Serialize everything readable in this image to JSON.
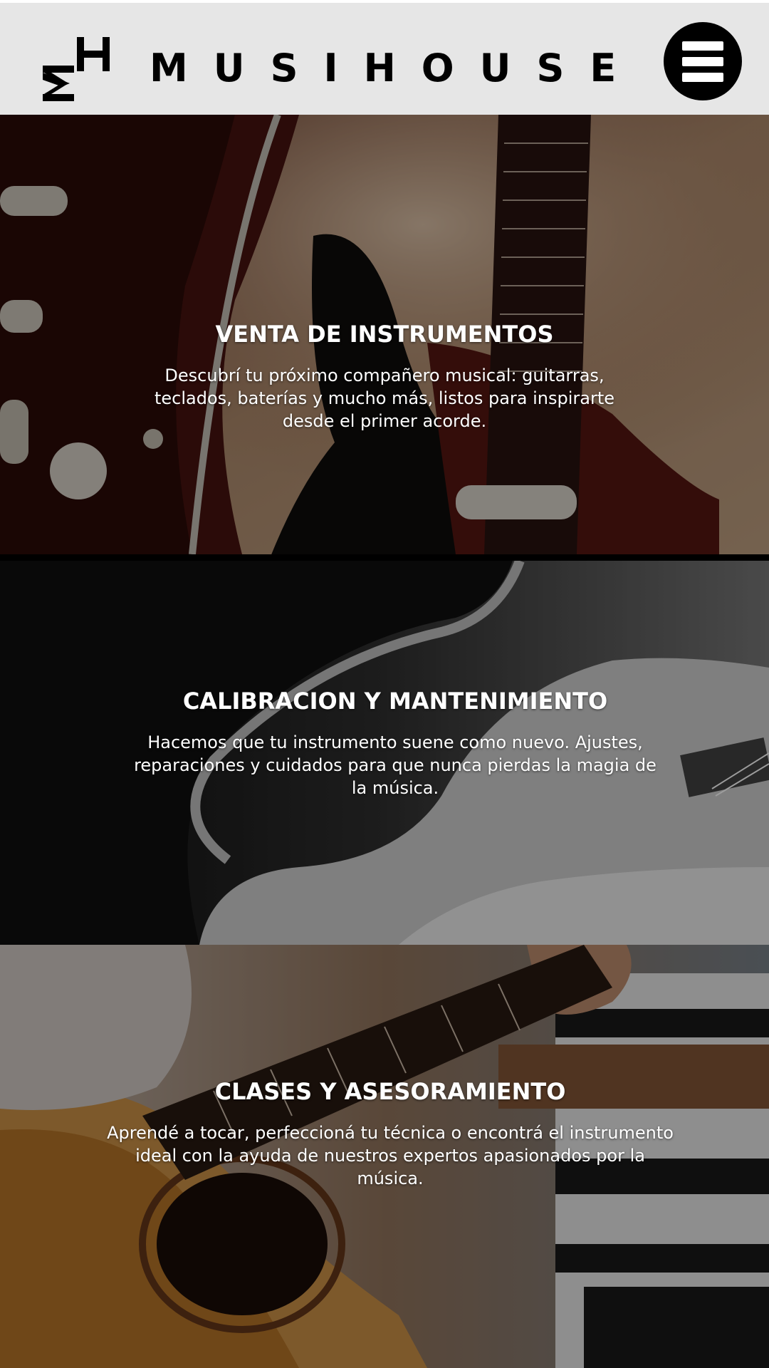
{
  "header": {
    "logo_text": "MH",
    "brand": "MUSIHOUSE",
    "menu_icon": "hamburger-menu-icon",
    "background": "#e6e6e6"
  },
  "sections": [
    {
      "title": "VENTA DE INSTRUMENTOS",
      "description": "Descubrí tu próximo compañero musical: guitarras, teclados, baterías y mucho más, listos para inspirarte desde el primer acorde.",
      "image": "electric-guitar-photo"
    },
    {
      "title": "CALIBRACION Y MANTENIMIENTO",
      "description": "Hacemos que tu instrumento suene como nuevo. Ajustes, reparaciones y cuidados para que nunca pierdas la magia de la música.",
      "image": "guitar-player-bw-photo"
    },
    {
      "title": "CLASES Y ASESORAMIENTO",
      "description": "Aprendé a tocar, perfeccioná tu técnica o encontrá el instrumento ideal con la ayuda de nuestros expertos apasionados por la música.",
      "image": "acoustic-guitar-piano-photo"
    }
  ]
}
